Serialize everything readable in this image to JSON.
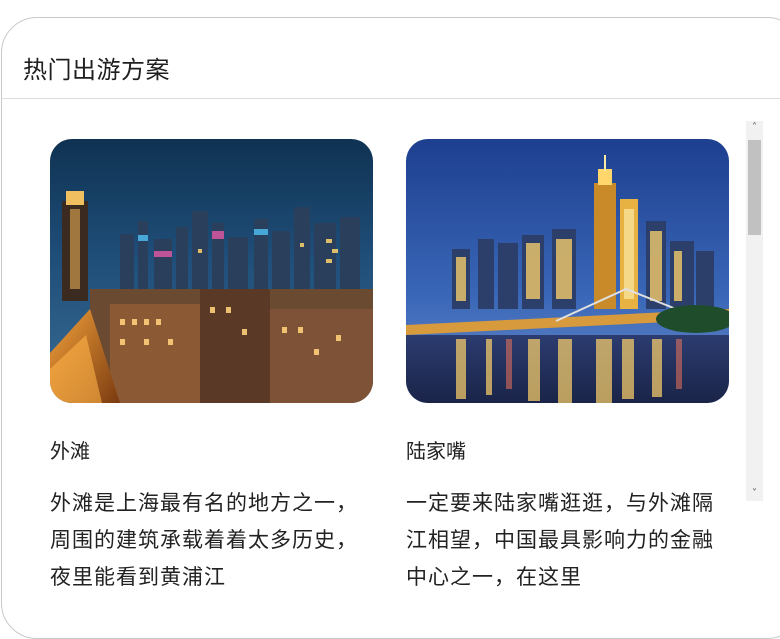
{
  "panel": {
    "title": "热门出游方案"
  },
  "spots": [
    {
      "name": "外滩",
      "description": "外滩是上海最有名的地方之一，周围的建筑承载着着太多历史，夜里能看到黄浦江"
    },
    {
      "name": "陆家嘴",
      "description": "一定要来陆家嘴逛逛，与外滩隔江相望，中国最具影响力的金融中心之一，在这里"
    }
  ],
  "scrollbar": {
    "up_arrow": "˄",
    "down_arrow": "˅"
  }
}
